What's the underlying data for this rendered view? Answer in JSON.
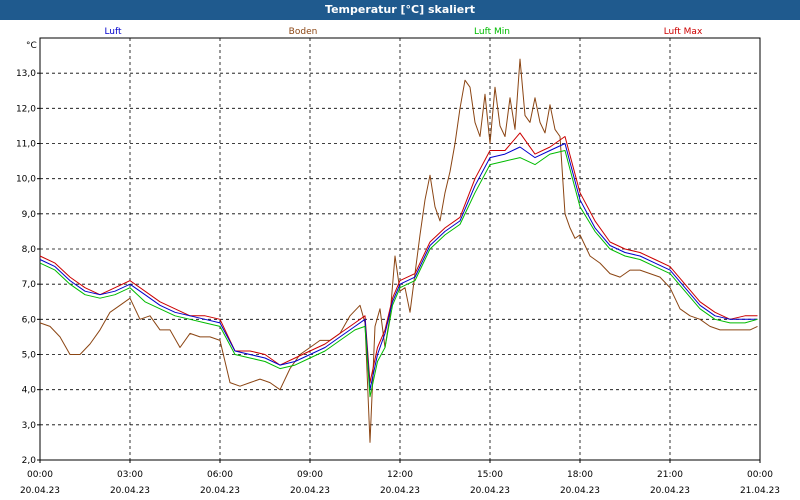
{
  "window": {
    "title": "Temperatur [°C] skaliert"
  },
  "colors": {
    "Luft": "#0000cc",
    "Boden": "#8b4513",
    "Luft Min": "#00bb00",
    "Luft Max": "#cc0000"
  },
  "chart_data": {
    "type": "line",
    "title": "Temperatur [°C] skaliert",
    "ylabel": "°C",
    "ylim": [
      2.0,
      14.0
    ],
    "xlim": [
      "2023-04-20 00:00",
      "2023-04-21 00:00"
    ],
    "grid": true,
    "legend": "top",
    "yticks": [
      "2,0",
      "3,0",
      "4,0",
      "5,0",
      "6,0",
      "7,0",
      "8,0",
      "9,0",
      "10,0",
      "11,0",
      "12,0",
      "13,0"
    ],
    "xticks": [
      {
        "time": "00:00",
        "date": "20.04.23"
      },
      {
        "time": "03:00",
        "date": "20.04.23"
      },
      {
        "time": "06:00",
        "date": "20.04.23"
      },
      {
        "time": "09:00",
        "date": "20.04.23"
      },
      {
        "time": "12:00",
        "date": "20.04.23"
      },
      {
        "time": "15:00",
        "date": "20.04.23"
      },
      {
        "time": "18:00",
        "date": "20.04.23"
      },
      {
        "time": "21:00",
        "date": "20.04.23"
      },
      {
        "time": "00:00",
        "date": "21.04.23"
      }
    ],
    "series": [
      {
        "name": "Luft",
        "x": [
          "00:00",
          "00:30",
          "01:00",
          "01:30",
          "02:00",
          "02:30",
          "03:00",
          "03:30",
          "04:00",
          "04:30",
          "05:00",
          "05:30",
          "06:00",
          "06:30",
          "07:00",
          "07:30",
          "08:00",
          "08:30",
          "09:00",
          "09:30",
          "10:00",
          "10:30",
          "10:50",
          "11:00",
          "11:15",
          "11:30",
          "11:45",
          "12:00",
          "12:30",
          "13:00",
          "13:30",
          "14:00",
          "14:30",
          "15:00",
          "15:30",
          "16:00",
          "16:30",
          "17:00",
          "17:30",
          "18:00",
          "18:30",
          "19:00",
          "19:30",
          "20:00",
          "20:30",
          "21:00",
          "21:30",
          "22:00",
          "22:30",
          "23:00",
          "23:30",
          "23:55"
        ],
        "values": [
          7.7,
          7.5,
          7.1,
          6.8,
          6.7,
          6.8,
          7.0,
          6.7,
          6.4,
          6.2,
          6.1,
          6.0,
          5.9,
          5.1,
          5.0,
          4.9,
          4.7,
          4.8,
          5.0,
          5.2,
          5.5,
          5.8,
          6.0,
          4.0,
          5.0,
          5.6,
          6.5,
          7.0,
          7.2,
          8.1,
          8.5,
          8.8,
          9.8,
          10.6,
          10.7,
          10.9,
          10.6,
          10.8,
          11.0,
          9.4,
          8.6,
          8.1,
          7.9,
          7.8,
          7.6,
          7.4,
          6.9,
          6.4,
          6.1,
          6.0,
          6.0,
          6.0
        ]
      },
      {
        "name": "Boden",
        "x": [
          "00:00",
          "00:20",
          "00:40",
          "01:00",
          "01:20",
          "01:40",
          "02:00",
          "02:20",
          "02:40",
          "03:00",
          "03:20",
          "03:40",
          "04:00",
          "04:20",
          "04:40",
          "05:00",
          "05:20",
          "05:40",
          "06:00",
          "06:20",
          "06:40",
          "07:00",
          "07:20",
          "07:40",
          "08:00",
          "08:20",
          "08:40",
          "09:00",
          "09:20",
          "09:40",
          "10:00",
          "10:20",
          "10:40",
          "10:50",
          "11:00",
          "11:10",
          "11:20",
          "11:30",
          "11:40",
          "11:50",
          "12:00",
          "12:10",
          "12:20",
          "12:30",
          "12:40",
          "12:50",
          "13:00",
          "13:10",
          "13:20",
          "13:30",
          "13:40",
          "13:50",
          "14:00",
          "14:10",
          "14:20",
          "14:30",
          "14:40",
          "14:50",
          "15:00",
          "15:10",
          "15:20",
          "15:30",
          "15:40",
          "15:50",
          "16:00",
          "16:10",
          "16:20",
          "16:30",
          "16:40",
          "16:50",
          "17:00",
          "17:10",
          "17:20",
          "17:30",
          "17:40",
          "17:50",
          "18:00",
          "18:20",
          "18:40",
          "19:00",
          "19:20",
          "19:40",
          "20:00",
          "20:20",
          "20:40",
          "21:00",
          "21:20",
          "21:40",
          "22:00",
          "22:20",
          "22:40",
          "23:00",
          "23:20",
          "23:40",
          "23:55"
        ],
        "values": [
          5.9,
          5.8,
          5.5,
          5.0,
          5.0,
          5.3,
          5.7,
          6.2,
          6.4,
          6.6,
          6.0,
          6.1,
          5.7,
          5.7,
          5.2,
          5.6,
          5.5,
          5.5,
          5.4,
          4.2,
          4.1,
          4.2,
          4.3,
          4.2,
          4.0,
          4.6,
          5.0,
          5.2,
          5.4,
          5.4,
          5.6,
          6.1,
          6.4,
          5.9,
          2.5,
          5.8,
          6.3,
          5.2,
          6.1,
          7.8,
          6.8,
          6.9,
          6.2,
          7.3,
          8.4,
          9.4,
          10.1,
          9.2,
          8.8,
          9.6,
          10.2,
          11.0,
          12.0,
          12.8,
          12.6,
          11.6,
          11.2,
          12.4,
          11.0,
          12.6,
          11.5,
          11.2,
          12.3,
          11.4,
          13.4,
          11.8,
          11.6,
          12.3,
          11.6,
          11.3,
          12.1,
          11.4,
          11.2,
          9.0,
          8.6,
          8.3,
          8.4,
          7.8,
          7.6,
          7.3,
          7.2,
          7.4,
          7.4,
          7.3,
          7.2,
          6.9,
          6.3,
          6.1,
          6.0,
          5.8,
          5.7,
          5.7,
          5.7,
          5.7,
          5.8
        ]
      },
      {
        "name": "Luft Min",
        "x": [
          "00:00",
          "00:30",
          "01:00",
          "01:30",
          "02:00",
          "02:30",
          "03:00",
          "03:30",
          "04:00",
          "04:30",
          "05:00",
          "05:30",
          "06:00",
          "06:30",
          "07:00",
          "07:30",
          "08:00",
          "08:30",
          "09:00",
          "09:30",
          "10:00",
          "10:30",
          "10:50",
          "11:00",
          "11:15",
          "11:30",
          "11:45",
          "12:00",
          "12:30",
          "13:00",
          "13:30",
          "14:00",
          "14:30",
          "15:00",
          "15:30",
          "16:00",
          "16:30",
          "17:00",
          "17:30",
          "18:00",
          "18:30",
          "19:00",
          "19:30",
          "20:00",
          "20:30",
          "21:00",
          "21:30",
          "22:00",
          "22:30",
          "23:00",
          "23:30",
          "23:55"
        ],
        "values": [
          7.6,
          7.4,
          7.0,
          6.7,
          6.6,
          6.7,
          6.9,
          6.5,
          6.3,
          6.1,
          6.0,
          5.9,
          5.8,
          5.0,
          4.9,
          4.8,
          4.6,
          4.7,
          4.9,
          5.1,
          5.4,
          5.7,
          5.8,
          3.8,
          4.8,
          5.2,
          6.4,
          6.9,
          7.1,
          8.0,
          8.4,
          8.7,
          9.6,
          10.4,
          10.5,
          10.6,
          10.4,
          10.7,
          10.8,
          9.2,
          8.5,
          8.0,
          7.8,
          7.7,
          7.5,
          7.3,
          6.8,
          6.3,
          6.0,
          5.9,
          5.9,
          6.0
        ]
      },
      {
        "name": "Luft Max",
        "x": [
          "00:00",
          "00:30",
          "01:00",
          "01:30",
          "02:00",
          "02:30",
          "03:00",
          "03:30",
          "04:00",
          "04:30",
          "05:00",
          "05:30",
          "06:00",
          "06:30",
          "07:00",
          "07:30",
          "08:00",
          "08:30",
          "09:00",
          "09:30",
          "10:00",
          "10:30",
          "10:50",
          "11:00",
          "11:15",
          "11:30",
          "11:45",
          "12:00",
          "12:30",
          "13:00",
          "13:30",
          "14:00",
          "14:30",
          "15:00",
          "15:30",
          "16:00",
          "16:30",
          "17:00",
          "17:30",
          "18:00",
          "18:30",
          "19:00",
          "19:30",
          "20:00",
          "20:30",
          "21:00",
          "21:30",
          "22:00",
          "22:30",
          "23:00",
          "23:30",
          "23:55"
        ],
        "values": [
          7.8,
          7.6,
          7.2,
          6.9,
          6.7,
          6.9,
          7.1,
          6.8,
          6.5,
          6.3,
          6.1,
          6.1,
          6.0,
          5.1,
          5.1,
          5.0,
          4.7,
          4.9,
          5.1,
          5.3,
          5.6,
          5.9,
          6.1,
          4.2,
          5.2,
          5.7,
          6.6,
          7.1,
          7.3,
          8.2,
          8.6,
          8.9,
          10.0,
          10.8,
          10.8,
          11.3,
          10.7,
          10.9,
          11.2,
          9.6,
          8.8,
          8.2,
          8.0,
          7.9,
          7.7,
          7.5,
          7.0,
          6.5,
          6.2,
          6.0,
          6.1,
          6.1
        ]
      }
    ]
  }
}
